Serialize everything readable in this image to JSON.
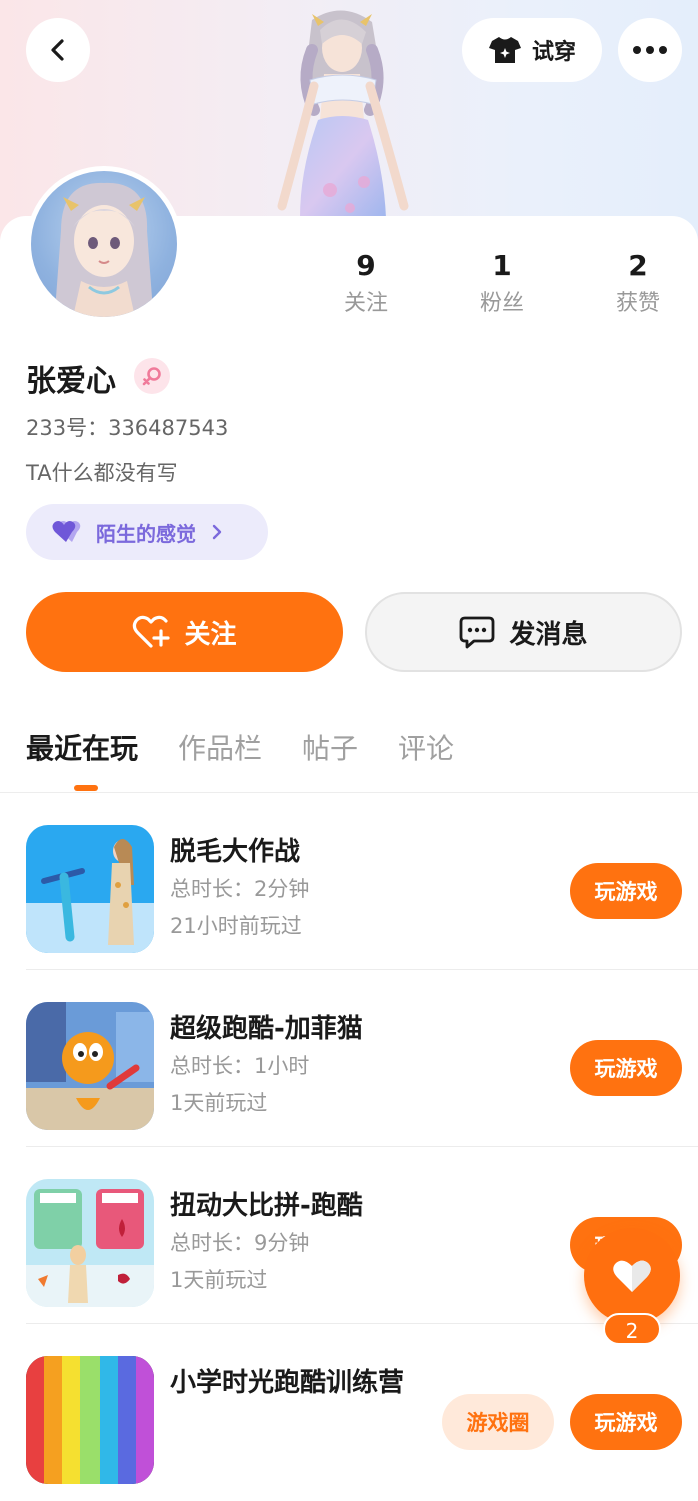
{
  "header": {
    "try_on_label": "试穿"
  },
  "profile": {
    "name": "张爱心",
    "id_line": "233号：336487543",
    "bio": "TA什么都没有写",
    "tag_label": "陌生的感觉",
    "stats": [
      {
        "value": "9",
        "label": "关注"
      },
      {
        "value": "1",
        "label": "粉丝"
      },
      {
        "value": "2",
        "label": "获赞"
      }
    ]
  },
  "actions": {
    "follow_label": "关注",
    "message_label": "发消息"
  },
  "tabs": [
    {
      "label": "最近在玩",
      "active": true
    },
    {
      "label": "作品栏",
      "active": false
    },
    {
      "label": "帖子",
      "active": false
    },
    {
      "label": "评论",
      "active": false
    }
  ],
  "games": [
    {
      "title": "脱毛大作战",
      "duration": "总时长：2分钟",
      "last_played": "21小时前玩过",
      "play_label": "玩游戏"
    },
    {
      "title": "超级跑酷-加菲猫",
      "duration": "总时长：1小时",
      "last_played": "1天前玩过",
      "play_label": "玩游戏"
    },
    {
      "title": "扭动大比拼-跑酷",
      "duration": "总时长：9分钟",
      "last_played": "1天前玩过",
      "play_label": "玩游戏"
    },
    {
      "title": "小学时光跑酷训练营",
      "duration": "",
      "last_played": "",
      "play_label": "玩游戏",
      "secondary_label": "游戏圈"
    }
  ],
  "floating_like": {
    "count": "2"
  },
  "colors": {
    "accent": "#ff7210",
    "tag_text": "#7b69dc",
    "tag_bg": "#ecebfb"
  }
}
